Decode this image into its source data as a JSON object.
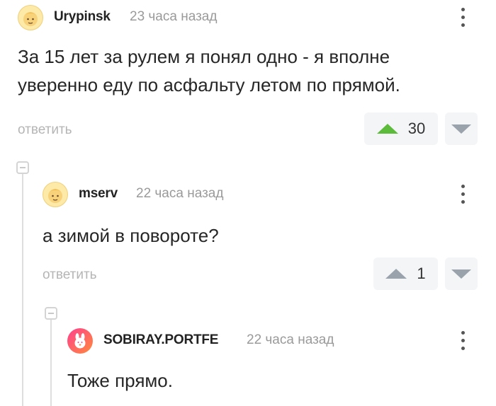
{
  "colors": {
    "upvote_active": "#5dbb3c",
    "upvote_inactive": "#9aa3ab",
    "downvote": "#9aa3ab",
    "reply_text": "#b5b5b5",
    "thread_line": "#dedede"
  },
  "comments": [
    {
      "username": "Urypinsk",
      "time": "23 часа назад",
      "text_line1": "За 15 лет за рулем я понял одно - я вполне",
      "text_line2": "уверенно еду по асфальту летом по прямой.",
      "reply_label": "ответить",
      "votes": "30",
      "avatar_icon": "face-avatar-icon",
      "menu_icon": "kebab-menu-icon"
    },
    {
      "username": "mserv",
      "time": "22 часа назад",
      "text": "а зимой в повороте?",
      "reply_label": "ответить",
      "votes": "1",
      "avatar_icon": "face-avatar-icon",
      "menu_icon": "kebab-menu-icon"
    },
    {
      "username": "SOBIRAY.PORTFE",
      "time": "22 часа назад",
      "text": "Тоже прямо.",
      "avatar_icon": "bunny-avatar-icon",
      "menu_icon": "kebab-menu-icon"
    }
  ]
}
